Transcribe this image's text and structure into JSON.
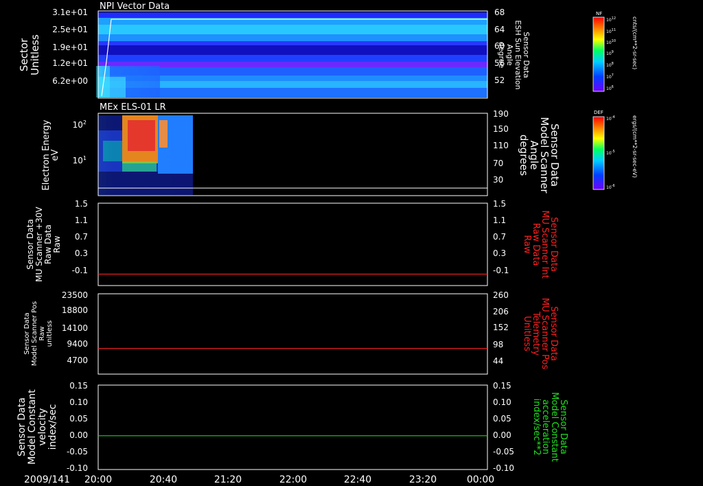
{
  "panels": [
    {
      "title": "NPI Vector Data",
      "left_label": [
        "Sector",
        "Unitless"
      ],
      "left_ticks": [
        "3.1e+01",
        "2.5e+01",
        "1.9e+01",
        "1.2e+01",
        "6.2e+00"
      ],
      "right_label": [
        "Sensor Data",
        "ESH Sun Elevation",
        "Angle",
        "degree"
      ],
      "right_ticks": [
        "68",
        "64",
        "60",
        "56",
        "52"
      ]
    },
    {
      "title": "MEx ELS-01 LR",
      "left_label": [
        "Electron Energy",
        "eV"
      ],
      "left_ticks": [
        "10",
        "10"
      ],
      "left_tick_exps": [
        "2",
        "1"
      ],
      "right_label": [
        "Sensor Data",
        "Model Scanner",
        "Angle",
        "degrees"
      ],
      "right_ticks": [
        "190",
        "150",
        "110",
        "70",
        "30"
      ]
    },
    {
      "title": "",
      "left_label": [
        "Sensor Data",
        "MU Scanner +30V",
        "Raw Data",
        "Raw"
      ],
      "left_ticks": [
        "1.5",
        "1.1",
        "0.7",
        "0.3",
        "-0.1"
      ],
      "right_label": [
        "Sensor Data",
        "MU Scanner Int",
        "Raw Data",
        "Raw"
      ],
      "right_ticks": [
        "1.5",
        "1.1",
        "0.7",
        "0.3",
        "-0.1"
      ]
    },
    {
      "title": "",
      "left_label": [
        "Sensor Data",
        "Model Scanner Pos",
        "Raw",
        "unitless"
      ],
      "left_ticks": [
        "23500",
        "18800",
        "14100",
        "9400",
        "4700"
      ],
      "right_label": [
        "Sensor Data",
        "MU Scanner Pos",
        "Telemetry",
        "Unitless"
      ],
      "right_ticks": [
        "260",
        "206",
        "152",
        "98",
        "44"
      ]
    },
    {
      "title": "",
      "left_label": [
        "Sensor Data",
        "Model Constant",
        "velocity",
        "index/sec"
      ],
      "left_ticks": [
        "0.15",
        "0.10",
        "0.05",
        "0.00",
        "-0.05",
        "-0.10"
      ],
      "right_label": [
        "Sensor Data",
        "Model Constant",
        "acceleration",
        "index/sec**2"
      ],
      "right_ticks": [
        "0.15",
        "0.10",
        "0.05",
        "0.00",
        "-0.05",
        "-0.10"
      ]
    }
  ],
  "x_axis": {
    "date": "2009/141",
    "ticks": [
      "20:00",
      "20:40",
      "21:20",
      "22:00",
      "22:40",
      "23:20",
      "00:00"
    ]
  },
  "colorbars": [
    {
      "tag": "NF",
      "unit": "cnts/(cm**2-sr-sec)",
      "ticks": [
        "10",
        "10",
        "10",
        "10",
        "10",
        "10",
        "10"
      ],
      "exps": [
        "12",
        "11",
        "10",
        "9",
        "8",
        "7",
        "6"
      ]
    },
    {
      "tag": "DEF",
      "unit": "ergs/(cm**2-sr-sec-eV)",
      "ticks": [
        "10",
        "10",
        "10"
      ],
      "exps": [
        "-4",
        "-5",
        "-6"
      ]
    }
  ],
  "colors": {
    "red_trace": "#ff2020",
    "green_trace": "#20d020",
    "right_label_red": "#ff2020",
    "right_label_green": "#20e020"
  },
  "chart_data": [
    {
      "type": "heatmap",
      "title": "NPI Vector Data",
      "ylabel": "Sector Unitless",
      "ylim": [
        0,
        31
      ],
      "y2label": "Sensor Data ESH Sun Elevation Angle degree",
      "y2lim": [
        48,
        68
      ],
      "x": [
        "20:00",
        "00:00"
      ],
      "overlay_line": {
        "x": [
          "20:00",
          "20:07",
          "20:13",
          "00:00"
        ],
        "y2": [
          48,
          55,
          67,
          67
        ]
      }
    },
    {
      "type": "heatmap",
      "title": "MEx ELS-01 LR",
      "ylabel": "Electron Energy eV",
      "yscale": "log",
      "y2label": "Sensor Data Model Scanner Angle degrees",
      "y2lim": [
        10,
        190
      ],
      "data_extent_x": [
        "20:00",
        "20:55"
      ],
      "overlay_line": {
        "x": [
          "20:00",
          "00:00"
        ],
        "y2": [
          10,
          10
        ]
      }
    },
    {
      "type": "line",
      "ylim": [
        -0.3,
        1.5
      ],
      "series": [
        {
          "x": [
            "20:00",
            "00:00"
          ],
          "values": [
            -0.05,
            -0.05
          ]
        }
      ]
    },
    {
      "type": "line",
      "ylim": [
        0,
        23500
      ],
      "series": [
        {
          "x": [
            "20:00",
            "00:00"
          ],
          "values": [
            7500,
            7500
          ]
        }
      ]
    },
    {
      "type": "line",
      "ylim": [
        -0.1,
        0.15
      ],
      "series": [
        {
          "x": [
            "20:00",
            "00:00"
          ],
          "values": [
            0.0,
            0.0
          ]
        }
      ]
    }
  ]
}
